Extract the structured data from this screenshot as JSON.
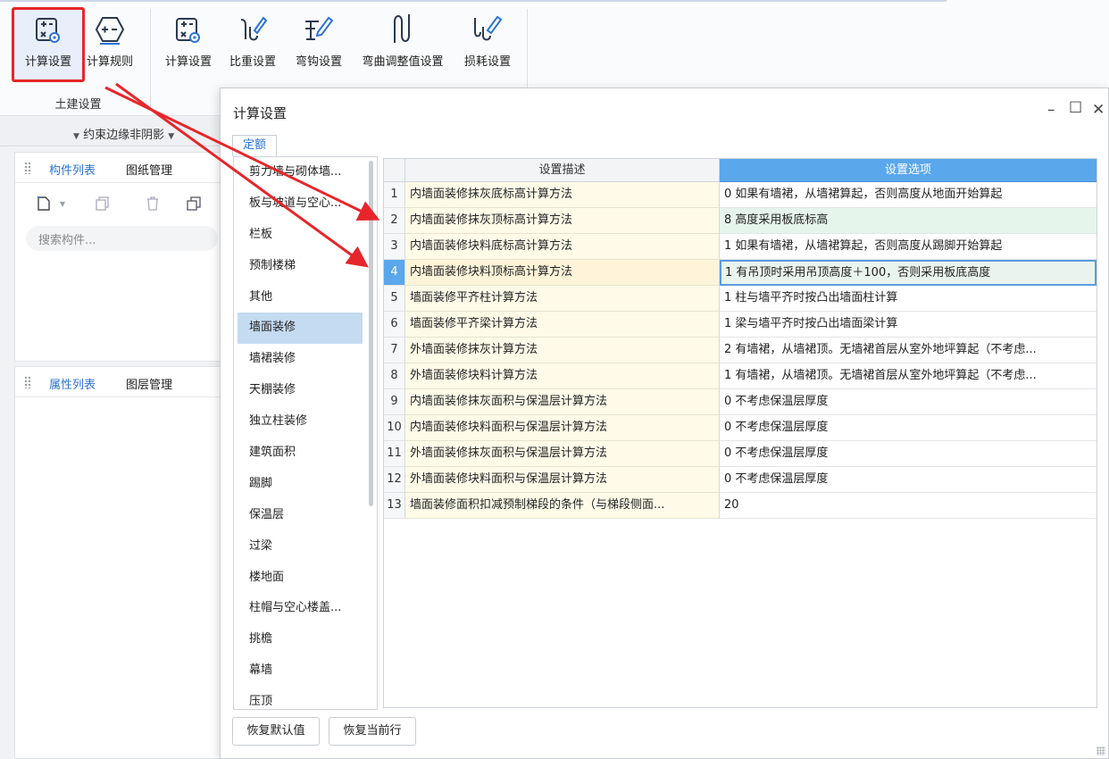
{
  "ribbon": {
    "buttons": [
      {
        "label": "计算设置",
        "icon": "calc-settings-icon"
      },
      {
        "label": "计算规则",
        "icon": "calc-rules-icon"
      },
      {
        "label": "计算设置",
        "icon": "calc-settings-icon"
      },
      {
        "label": "比重设置",
        "icon": "weight-settings-icon"
      },
      {
        "label": "弯钩设置",
        "icon": "hook-settings-icon"
      },
      {
        "label": "弯曲调整值设置",
        "icon": "bend-adjust-icon"
      },
      {
        "label": "损耗设置",
        "icon": "loss-settings-icon"
      }
    ],
    "group_label": "土建设置",
    "highlight_color": "#e6262a"
  },
  "strip": {
    "dropdown_label": "约束边缘非阴影"
  },
  "component_panel": {
    "tabs": [
      "构件列表",
      "图纸管理"
    ],
    "search_placeholder": "搜索构件..."
  },
  "property_panel": {
    "tabs": [
      "属性列表",
      "图层管理"
    ]
  },
  "dialog": {
    "title": "计算设置",
    "tab": "定额",
    "categories": [
      "剪力墙与砌体墙...",
      "板与坡道与空心...",
      "栏板",
      "预制楼梯",
      "其他",
      "墙面装修",
      "墙裙装修",
      "天棚装修",
      "独立柱装修",
      "建筑面积",
      "踢脚",
      "保温层",
      "过梁",
      "楼地面",
      "柱帽与空心楼盖...",
      "挑檐",
      "幕墙",
      "压顶"
    ],
    "selected_category": "墙面装修",
    "headers": {
      "description": "设置描述",
      "option": "设置选项"
    },
    "rows": [
      {
        "num": "1",
        "desc": "内墙面装修抹灰底标高计算方法",
        "option": "0 如果有墙裙，从墙裙算起，否则高度从地面开始算起"
      },
      {
        "num": "2",
        "desc": "内墙面装修抹灰顶标高计算方法",
        "option": "8 高度采用板底标高"
      },
      {
        "num": "3",
        "desc": "内墙面装修块料底标高计算方法",
        "option": "1 如果有墙裙，从墙裙算起，否则高度从踢脚开始算起"
      },
      {
        "num": "4",
        "desc": "内墙面装修块料顶标高计算方法",
        "option": "1 有吊顶时采用吊顶高度＋100，否则采用板底高度"
      },
      {
        "num": "5",
        "desc": "墙面装修平齐柱计算方法",
        "option": "1 柱与墙平齐时按凸出墙面柱计算"
      },
      {
        "num": "6",
        "desc": "墙面装修平齐梁计算方法",
        "option": "1 梁与墙平齐时按凸出墙面梁计算"
      },
      {
        "num": "7",
        "desc": "外墙面装修抹灰计算方法",
        "option": "2 有墙裙，从墙裙顶。无墙裙首层从室外地坪算起（不考虑..."
      },
      {
        "num": "8",
        "desc": "外墙面装修块料计算方法",
        "option": "1 有墙裙，从墙裙顶。无墙裙首层从室外地坪算起（不考虑..."
      },
      {
        "num": "9",
        "desc": "内墙面装修抹灰面积与保温层计算方法",
        "option": "0 不考虑保温层厚度"
      },
      {
        "num": "10",
        "desc": "内墙面装修块料面积与保温层计算方法",
        "option": "0 不考虑保温层厚度"
      },
      {
        "num": "11",
        "desc": "外墙面装修抹灰面积与保温层计算方法",
        "option": "0 不考虑保温层厚度"
      },
      {
        "num": "12",
        "desc": "外墙面装修块料面积与保温层计算方法",
        "option": "0 不考虑保温层厚度"
      },
      {
        "num": "13",
        "desc": "墙面装修面积扣减预制梯段的条件（与梯段侧面...",
        "option": "20"
      }
    ],
    "buttons": {
      "restore_default": "恢复默认值",
      "restore_row": "恢复当前行"
    },
    "accent_color": "#5aa7ec"
  }
}
